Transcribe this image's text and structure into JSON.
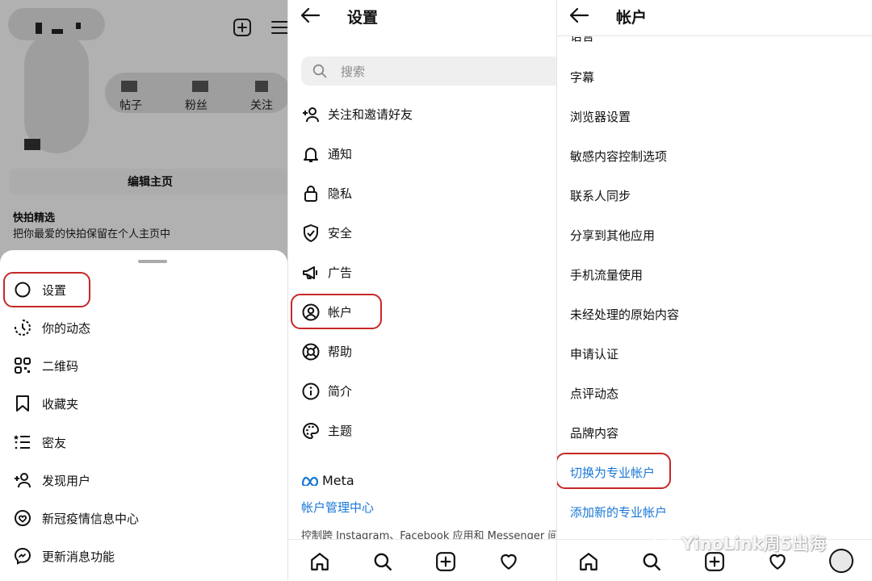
{
  "profile": {
    "stats": [
      "帖子",
      "粉丝",
      "关注"
    ],
    "edit_profile_button": "编辑主页",
    "highlights_title": "快拍精选",
    "highlights_subtitle": "把你最爱的快拍保留在个人主页中"
  },
  "sheet_menu": {
    "items": [
      {
        "label": "设置",
        "icon": "gear-icon"
      },
      {
        "label": "你的动态",
        "icon": "activity-icon"
      },
      {
        "label": "二维码",
        "icon": "qr-code-icon"
      },
      {
        "label": "收藏夹",
        "icon": "bookmark-icon"
      },
      {
        "label": "密友",
        "icon": "close-friends-icon"
      },
      {
        "label": "发现用户",
        "icon": "add-user-icon"
      },
      {
        "label": "新冠疫情信息中心",
        "icon": "covid-info-icon"
      },
      {
        "label": "更新消息功能",
        "icon": "messenger-icon"
      }
    ]
  },
  "settings": {
    "title": "设置",
    "search_placeholder": "搜索",
    "items": [
      {
        "label": "关注和邀请好友",
        "icon": "add-user-icon"
      },
      {
        "label": "通知",
        "icon": "bell-icon"
      },
      {
        "label": "隐私",
        "icon": "lock-icon"
      },
      {
        "label": "安全",
        "icon": "shield-icon"
      },
      {
        "label": "广告",
        "icon": "megaphone-icon"
      },
      {
        "label": "帐户",
        "icon": "account-icon"
      },
      {
        "label": "帮助",
        "icon": "lifebuoy-icon"
      },
      {
        "label": "简介",
        "icon": "info-icon"
      },
      {
        "label": "主题",
        "icon": "palette-icon"
      }
    ],
    "meta_brand": "Meta",
    "meta_link": "帐户管理中心",
    "meta_desc": "控制跨 Instagram、Facebook 应用和 Messenger 间"
  },
  "account": {
    "title": "帐户",
    "partial_top": "语言",
    "items": [
      "字幕",
      "浏览器设置",
      "敏感内容控制选项",
      "联系人同步",
      "分享到其他应用",
      "手机流量使用",
      "未经处理的原始内容",
      "申请认证",
      "点评动态",
      "品牌内容"
    ],
    "links": [
      "切换为专业帐户",
      "添加新的专业帐户"
    ]
  },
  "watermark": "YinoLink周5出海",
  "colors": {
    "link": "#1877d6",
    "highlight_box": "#c62828"
  }
}
